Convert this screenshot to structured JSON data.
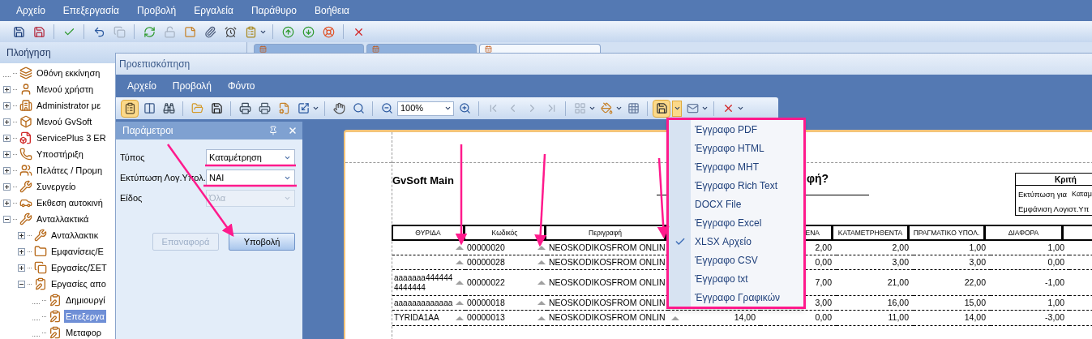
{
  "menu_bar": [
    "Αρχείο",
    "Επεξεργασία",
    "Προβολή",
    "Εργαλεία",
    "Παράθυρο",
    "Βοήθεια"
  ],
  "document_tabs": [
    {
      "selected": false
    },
    {
      "selected": false
    },
    {
      "selected": true
    }
  ],
  "navigation": {
    "title": "Πλοήγηση",
    "tree": [
      {
        "label": "Οθόνη εκκίνηση",
        "kind": "leaf",
        "selected": false
      },
      {
        "label": "Μενού χρήστη",
        "kind": "node",
        "expanded": false,
        "selected": false
      },
      {
        "label": "Administrator με",
        "kind": "node",
        "expanded": false,
        "selected": false
      },
      {
        "label": "Μενού GvSoft",
        "kind": "node",
        "expanded": false,
        "selected": false
      },
      {
        "label": "ServicePlus 3 ER",
        "kind": "node",
        "expanded": false,
        "selected": false
      },
      {
        "label": "Υποστήριξη",
        "kind": "node",
        "expanded": false,
        "selected": false
      },
      {
        "label": "Πελάτες / Προμη",
        "kind": "node",
        "expanded": false,
        "selected": false
      },
      {
        "label": "Συνεργείο",
        "kind": "node",
        "expanded": false,
        "selected": false
      },
      {
        "label": "Εκθεση αυτοκινή",
        "kind": "node",
        "expanded": false,
        "selected": false
      },
      {
        "label": "Ανταλλακτικά",
        "kind": "node",
        "expanded": true,
        "selected": false,
        "children": [
          {
            "label": "Ανταλλακτικ",
            "kind": "node",
            "expanded": false,
            "selected": false
          },
          {
            "label": "Εμφανίσεις/Ε",
            "kind": "node",
            "expanded": false,
            "selected": false
          },
          {
            "label": "Εργασίες/ΣΕΤ",
            "kind": "node",
            "expanded": false,
            "selected": false
          },
          {
            "label": "Εργασίες απο",
            "kind": "node",
            "expanded": true,
            "selected": false,
            "children": [
              {
                "label": "Δημιουργί",
                "kind": "leaf",
                "selected": false
              },
              {
                "label": "Επεξεργα",
                "kind": "leaf",
                "selected": true
              },
              {
                "label": "Μεταφορ",
                "kind": "leaf",
                "selected": false
              }
            ]
          }
        ]
      }
    ]
  },
  "preview": {
    "title": "Προεπισκόπηση",
    "menu": [
      "Αρχείο",
      "Προβολή",
      "Φόντο"
    ],
    "zoom": "100%",
    "parameters": {
      "title": "Παράμετροι",
      "fields": [
        {
          "label": "Τύπος",
          "value": "Καταμέτρηση",
          "disabled": false
        },
        {
          "label": "Εκτύπωση Λογ.Υπολ.",
          "value": "ΝΑΙ",
          "disabled": false
        },
        {
          "label": "Είδος",
          "value": "Όλα",
          "disabled": true
        }
      ],
      "buttons": [
        {
          "label": "Επαναφορά",
          "disabled": true
        },
        {
          "label": "Υποβολή",
          "disabled": false
        }
      ]
    },
    "report": {
      "title": "GvSoft Main",
      "heading": "φή?",
      "criteria": {
        "title": "Κριτή",
        "rows": [
          {
            "label": "Εκτύπωση για",
            "value": "Καταμ"
          },
          {
            "label": "Εμφάνιση Λογιστ.Υπ"
          }
        ]
      },
      "columns": {
        "thyrida": "ΘΥΡΙΔΑ",
        "code": "Κωδικός",
        "description": "Περιγραφή",
        "column_5": "ΕΝΑ",
        "counted": "ΚΑΤΑΜΕΤΡΗΘΕΝΤΑ",
        "actual": "ΠΡΑΓΜΑΤΙΚΟ ΥΠΟΛ.",
        "difference": "ΔΙΑΦΟΡΑ"
      },
      "rows": [
        {
          "code": "00000020",
          "description": "NEOSKODIKOSFROM ONLIN",
          "column_5": "2,00",
          "counted": "2,00",
          "actual": "1,00",
          "difference": "1,00"
        },
        {
          "code": "00000028",
          "description": "NEOSKODIKOSFROM ONLIN",
          "column_5": "0,00",
          "counted": "3,00",
          "actual": "3,00",
          "difference": "0,00"
        },
        {
          "thyrida": "aaaaaaa4444444444444",
          "code": "00000022",
          "description": "NEOSKODIKOSFROM ONLIN",
          "column_5": "7,00",
          "counted": "21,00",
          "actual": "22,00",
          "difference": "-1,00"
        },
        {
          "thyrida": "aaaaaaaaaaaaa",
          "code": "00000018",
          "description": "NEOSKODIKOSFROM ONLIN",
          "column_5": "3,00",
          "counted": "16,00",
          "actual": "15,00",
          "difference": "1,00"
        },
        {
          "thyrida": "TYRIDA1AA",
          "code": "00000013",
          "description": "NEOSKODIKOSFROM ONLIN",
          "column_4": "14,00",
          "column_5": "0,00",
          "counted": "11,00",
          "actual": "14,00",
          "difference": "-3,00"
        }
      ]
    },
    "export_menu": [
      {
        "label": "Έγγραφο PDF",
        "checked": false
      },
      {
        "label": "Έγγραφο HTML",
        "checked": false
      },
      {
        "label": "Έγγραφο MHT",
        "checked": false
      },
      {
        "label": "Έγγραφο Rich Text",
        "checked": false
      },
      {
        "label": "DOCX File",
        "checked": false
      },
      {
        "label": "Έγγραφο Excel",
        "checked": false
      },
      {
        "label": "XLSX Αρχείο",
        "checked": true
      },
      {
        "label": "Έγγραφο CSV",
        "checked": false
      },
      {
        "label": "Έγγραφο txt",
        "checked": false
      },
      {
        "label": "Έγγραφο Γραφικών",
        "checked": false
      }
    ]
  }
}
